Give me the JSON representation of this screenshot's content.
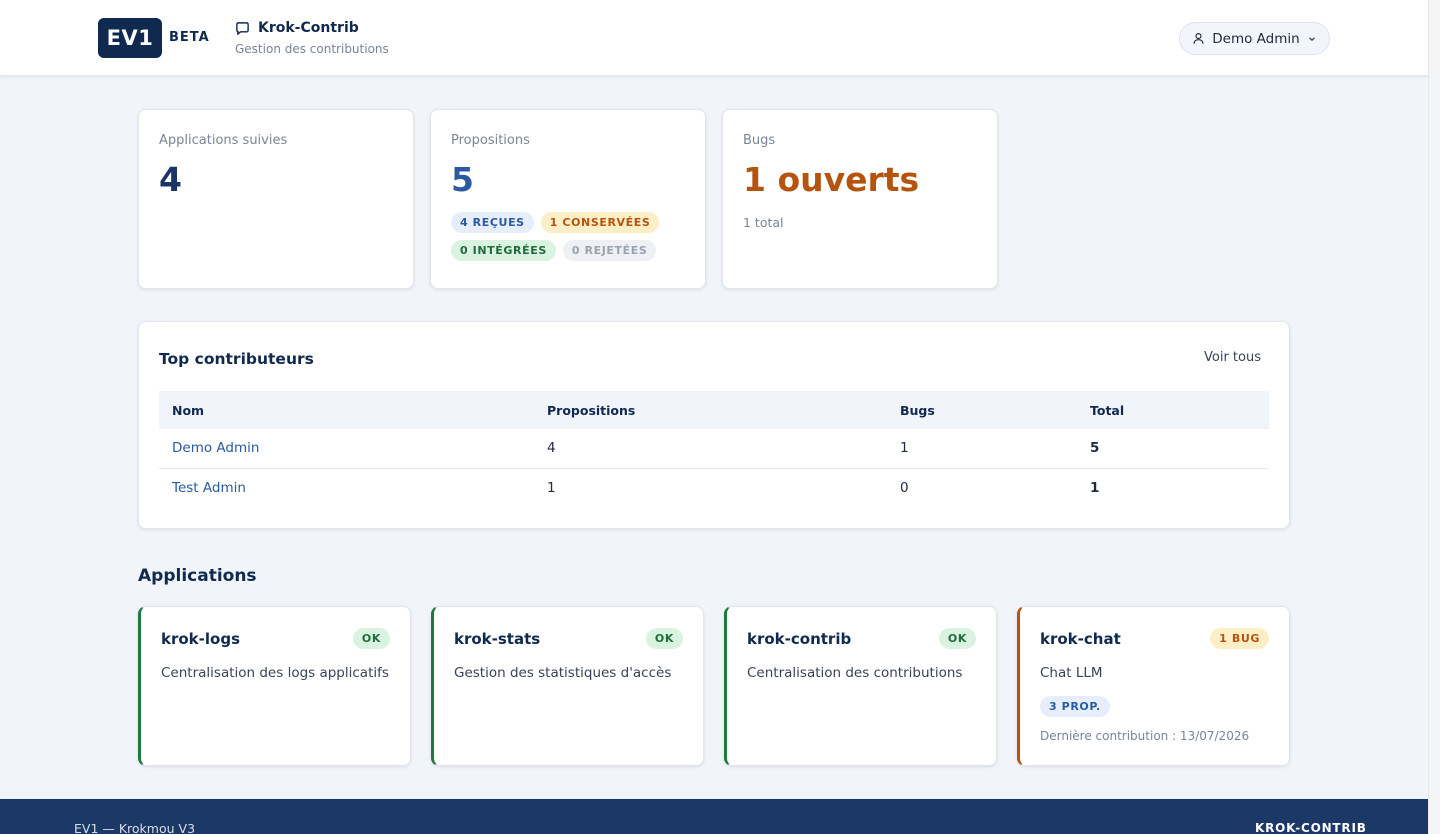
{
  "header": {
    "logo": "EV1",
    "beta": "BETA",
    "app_title": "Krok-Contrib",
    "app_subtitle": "Gestion des contributions",
    "user": "Demo Admin"
  },
  "stats": {
    "applications": {
      "label": "Applications suivies",
      "value": "4"
    },
    "propositions": {
      "label": "Propositions",
      "value": "5",
      "badges": {
        "recues": "4 REÇUES",
        "conservees": "1 CONSERVÉES",
        "integrees": "0 INTÉGRÉES",
        "rejetees": "0 REJETÉES"
      }
    },
    "bugs": {
      "label": "Bugs",
      "value": "1 ouverts",
      "sub": "1 total"
    }
  },
  "contributors": {
    "title": "Top contributeurs",
    "view_all": "Voir tous",
    "columns": [
      "Nom",
      "Propositions",
      "Bugs",
      "Total"
    ],
    "rows": [
      {
        "name": "Demo Admin",
        "propositions": "4",
        "bugs": "1",
        "total": "5"
      },
      {
        "name": "Test Admin",
        "propositions": "1",
        "bugs": "0",
        "total": "1"
      }
    ]
  },
  "applications": {
    "title": "Applications",
    "items": [
      {
        "name": "krok-logs",
        "status": "OK",
        "description": "Centralisation des logs applicatifs"
      },
      {
        "name": "krok-stats",
        "status": "OK",
        "description": "Gestion des statistiques d'accès"
      },
      {
        "name": "krok-contrib",
        "status": "OK",
        "description": "Centralisation des contributions"
      },
      {
        "name": "krok-chat",
        "status": "1 BUG",
        "description": "Chat LLM",
        "proposals": "3 PROP.",
        "last_contribution": "Dernière contribution : 13/07/2026"
      }
    ]
  },
  "footer": {
    "left": "EV1 — Krokmou V3",
    "right": "KROK-CONTRIB"
  },
  "colors": {
    "navy": "#10294f",
    "accent_blue": "#2a5aa0",
    "warning": "#b5540f",
    "success": "#1f7a3e",
    "footer_bg": "#1c3866"
  }
}
